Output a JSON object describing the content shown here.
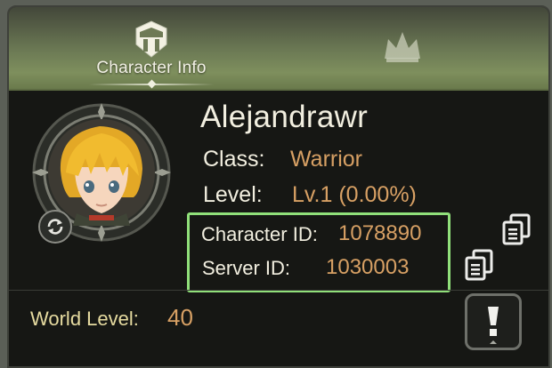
{
  "tabs": {
    "character_info": {
      "label": "Character Info",
      "icon": "helmet-icon"
    },
    "second": {
      "icon": "crown-icon"
    }
  },
  "character": {
    "name": "Alejandrawr",
    "class_label": "Class:",
    "class_value": "Warrior",
    "level_label": "Level:",
    "level_value": "Lv.1 (0.00%)",
    "character_id_label": "Character ID:",
    "character_id_value": "1078890",
    "server_id_label": "Server ID:",
    "server_id_value": "1030003"
  },
  "world": {
    "label": "World Level:",
    "value": "40"
  },
  "colors": {
    "value_gold": "#d7a064",
    "highlight_green": "#90e07a",
    "header_green": "#7e8f5d"
  }
}
